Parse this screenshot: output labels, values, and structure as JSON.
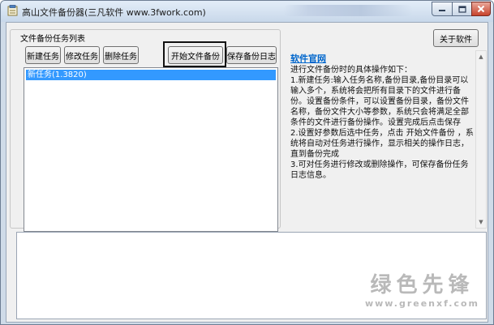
{
  "window": {
    "title": "高山文件备份器(三凡软件 www.3fwork.com)",
    "buttons": [
      "minimize",
      "maximize",
      "close"
    ]
  },
  "task_group": {
    "title": "文件备份任务列表",
    "toolbar": {
      "new_task": "新建任务",
      "edit_task": "修改任务",
      "delete_task": "删除任务",
      "start_backup": "开始文件备份",
      "save_log": "保存备份日志"
    },
    "tasks": [
      {
        "label": "新任务(1.3820)",
        "selected": true
      }
    ]
  },
  "about_button": "关于软件",
  "info_panel": {
    "link": "软件官网",
    "text": "进行文件备份时的具体操作如下：\n1.新建任务:输入任务名称,备份目录,备份目录可以输入多个，系统将会把所有目录下的文件进行备份。设置备份条件，可以设置备份目录，备份文件名称，备份文件大小等参数，系统只会将满足全部条件的文件进行备份操作。设置完成后点击保存\n2.设置好参数后选中任务，点击 开始文件备份 ，系统将自动对任务进行操作，显示相关的操作日志，直到备份完成\n3.可对任务进行修改或删除操作，可保存备份任务日志信息。"
  },
  "watermark": {
    "main": "绿色先锋",
    "url": "www.greenxf.com"
  },
  "colors": {
    "selection": "#3399ff",
    "link": "#0066cc",
    "highlight_border": "#111111"
  },
  "icons": [
    "app-icon",
    "minimize-icon",
    "maximize-icon",
    "close-icon",
    "scroll-up-arrow-icon",
    "scroll-down-arrow-icon"
  ]
}
